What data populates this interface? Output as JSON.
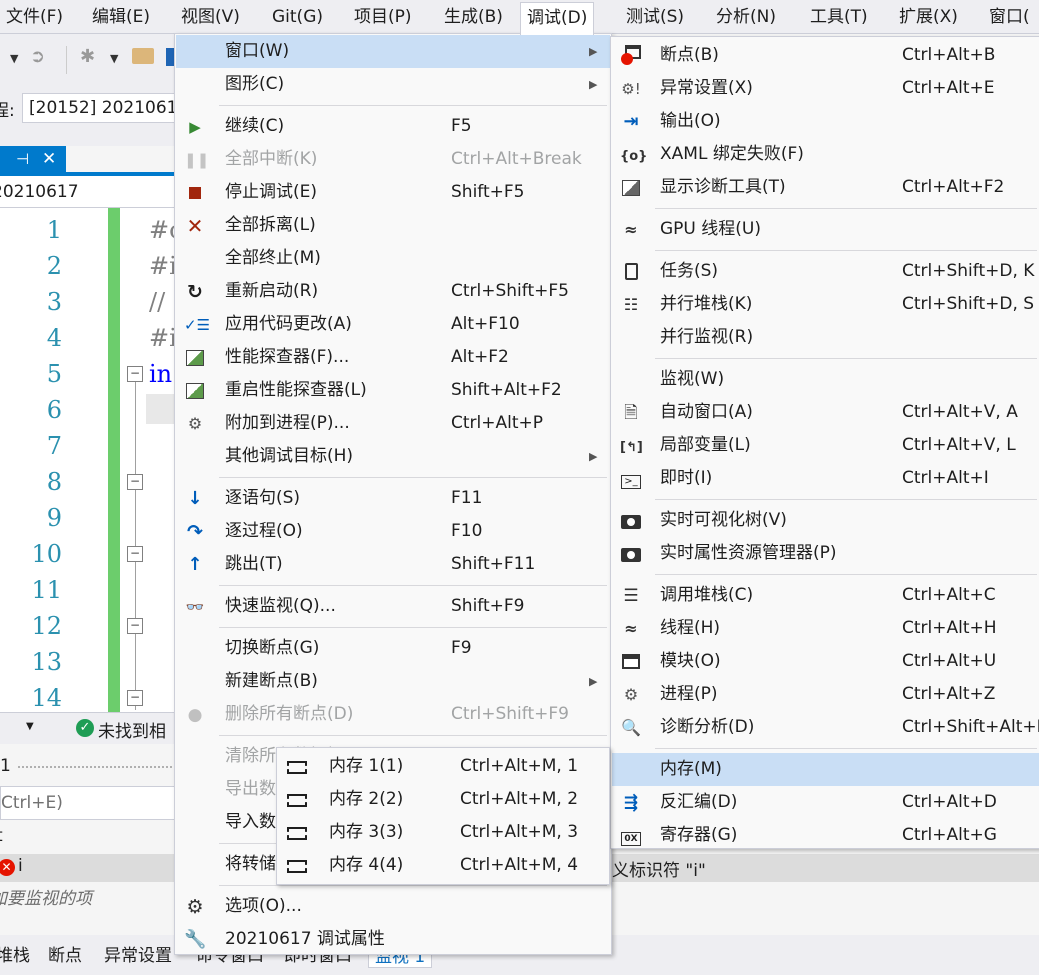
{
  "menubar": [
    "文件(F)",
    "编辑(E)",
    "视图(V)",
    "Git(G)",
    "项目(P)",
    "生成(B)",
    "调试(D)",
    "测试(S)",
    "分析(N)",
    "工具(T)",
    "扩展(X)",
    "窗口("
  ],
  "process_label": "程:",
  "process_value": "[20152] 2021061",
  "doc_tab_pin": "⊣",
  "doc_tab_close": "✕",
  "file_name": "20210617",
  "line_numbers": [
    "1",
    "2",
    "3",
    "4",
    "5",
    "6",
    "7",
    "8",
    "9",
    "10",
    "11",
    "12",
    "13",
    "14"
  ],
  "code_lines": [
    "#c",
    "#i",
    "//",
    "#i",
    "in",
    "{"
  ],
  "status_text": "未找到相关",
  "lower_pane": {
    "row1": "1",
    "search": "Ctrl+E)",
    "row3": "t",
    "watch_item": "i",
    "hint": "加要监视的项"
  },
  "bottom_tabs": [
    "堆栈",
    "断点",
    "异常设置",
    "命令窗口",
    "即时窗口",
    "监视 1"
  ],
  "error_tail": "义标识符 \"i\"",
  "debug_menu": [
    {
      "label": "窗口(W)",
      "shortcut": "",
      "icon": "",
      "submenu": true,
      "highlighted": true
    },
    {
      "label": "图形(C)",
      "shortcut": "",
      "icon": "",
      "submenu": true
    },
    {
      "sep": true
    },
    {
      "label": "继续(C)",
      "shortcut": "F5",
      "icon": "play-icon"
    },
    {
      "label": "全部中断(K)",
      "shortcut": "Ctrl+Alt+Break",
      "icon": "pause-icon",
      "disabled": true
    },
    {
      "label": "停止调试(E)",
      "shortcut": "Shift+F5",
      "icon": "stop-icon"
    },
    {
      "label": "全部拆离(L)",
      "shortcut": "",
      "icon": "detach-icon"
    },
    {
      "label": "全部终止(M)",
      "shortcut": "",
      "icon": ""
    },
    {
      "label": "重新启动(R)",
      "shortcut": "Ctrl+Shift+F5",
      "icon": "restart-icon"
    },
    {
      "label": "应用代码更改(A)",
      "shortcut": "Alt+F10",
      "icon": "apply-changes-icon"
    },
    {
      "label": "性能探查器(F)...",
      "shortcut": "Alt+F2",
      "icon": "profiler-icon"
    },
    {
      "label": "重启性能探查器(L)",
      "shortcut": "Shift+Alt+F2",
      "icon": "profiler-icon"
    },
    {
      "label": "附加到进程(P)...",
      "shortcut": "Ctrl+Alt+P",
      "icon": "attach-process-icon"
    },
    {
      "label": "其他调试目标(H)",
      "shortcut": "",
      "icon": "",
      "submenu": true
    },
    {
      "sep": true
    },
    {
      "label": "逐语句(S)",
      "shortcut": "F11",
      "icon": "step-into-icon"
    },
    {
      "label": "逐过程(O)",
      "shortcut": "F10",
      "icon": "step-over-icon"
    },
    {
      "label": "跳出(T)",
      "shortcut": "Shift+F11",
      "icon": "step-out-icon"
    },
    {
      "sep": true
    },
    {
      "label": "快速监视(Q)...",
      "shortcut": "Shift+F9",
      "icon": "quickwatch-icon"
    },
    {
      "sep": true
    },
    {
      "label": "切换断点(G)",
      "shortcut": "F9",
      "icon": ""
    },
    {
      "label": "新建断点(B)",
      "shortcut": "",
      "icon": "",
      "submenu": true
    },
    {
      "label": "删除所有断点(D)",
      "shortcut": "Ctrl+Shift+F9",
      "icon": "delete-breakpoints-icon",
      "disabled": true
    },
    {
      "sep": true
    },
    {
      "label": "清除所有数据提示(A)",
      "shortcut": "",
      "icon": "",
      "disabled": true
    },
    {
      "label": "导出数据提示(X)...",
      "shortcut": "",
      "icon": "",
      "disabled": true
    },
    {
      "label": "导入数据提示(P)...",
      "shortcut": "",
      "icon": ""
    },
    {
      "sep": true
    },
    {
      "label": "将转储另存为(V)...",
      "shortcut": "",
      "icon": ""
    },
    {
      "sep": true
    },
    {
      "label": "选项(O)...",
      "shortcut": "",
      "icon": "gear-icon"
    },
    {
      "label": "20210617 调试属性",
      "shortcut": "",
      "icon": "wrench-icon"
    }
  ],
  "window_menu": [
    {
      "label": "断点(B)",
      "shortcut": "Ctrl+Alt+B",
      "icon": "breakpoints-icon"
    },
    {
      "label": "异常设置(X)",
      "shortcut": "Ctrl+Alt+E",
      "icon": "exception-settings-icon"
    },
    {
      "label": "输出(O)",
      "shortcut": "",
      "icon": "output-icon"
    },
    {
      "label": "XAML 绑定失败(F)",
      "shortcut": "",
      "icon": "xaml-binding-icon"
    },
    {
      "label": "显示诊断工具(T)",
      "shortcut": "Ctrl+Alt+F2",
      "icon": "diagnostic-tools-icon"
    },
    {
      "sep": true
    },
    {
      "label": "GPU 线程(U)",
      "shortcut": "",
      "icon": "gpu-threads-icon"
    },
    {
      "sep": true
    },
    {
      "label": "任务(S)",
      "shortcut": "Ctrl+Shift+D, K",
      "icon": "tasks-icon"
    },
    {
      "label": "并行堆栈(K)",
      "shortcut": "Ctrl+Shift+D, S",
      "icon": "parallel-stacks-icon"
    },
    {
      "label": "并行监视(R)",
      "shortcut": "",
      "icon": ""
    },
    {
      "sep": true
    },
    {
      "label": "监视(W)",
      "shortcut": "",
      "icon": ""
    },
    {
      "label": "自动窗口(A)",
      "shortcut": "Ctrl+Alt+V, A",
      "icon": "autos-icon"
    },
    {
      "label": "局部变量(L)",
      "shortcut": "Ctrl+Alt+V, L",
      "icon": "locals-icon"
    },
    {
      "label": "即时(I)",
      "shortcut": "Ctrl+Alt+I",
      "icon": "immediate-icon"
    },
    {
      "sep": true
    },
    {
      "label": "实时可视化树(V)",
      "shortcut": "",
      "icon": "camera-icon"
    },
    {
      "label": "实时属性资源管理器(P)",
      "shortcut": "",
      "icon": "camera-icon"
    },
    {
      "sep": true
    },
    {
      "label": "调用堆栈(C)",
      "shortcut": "Ctrl+Alt+C",
      "icon": "call-stack-icon"
    },
    {
      "label": "线程(H)",
      "shortcut": "Ctrl+Alt+H",
      "icon": "threads-icon"
    },
    {
      "label": "模块(O)",
      "shortcut": "Ctrl+Alt+U",
      "icon": "modules-icon"
    },
    {
      "label": "进程(P)",
      "shortcut": "Ctrl+Alt+Z",
      "icon": "processes-icon"
    },
    {
      "label": "诊断分析(D)",
      "shortcut": "Ctrl+Shift+Alt+D",
      "icon": "diagnostic-analysis-icon"
    },
    {
      "sep": true
    },
    {
      "label": "内存(M)",
      "shortcut": "",
      "icon": "",
      "highlighted": true
    },
    {
      "label": "反汇编(D)",
      "shortcut": "Ctrl+Alt+D",
      "icon": "disassembly-icon"
    },
    {
      "label": "寄存器(G)",
      "shortcut": "Ctrl+Alt+G",
      "icon": "registers-icon"
    }
  ],
  "memory_menu": [
    {
      "label": "内存 1(1)",
      "shortcut": "Ctrl+Alt+M, 1",
      "icon": "memory-chip-icon"
    },
    {
      "label": "内存 2(2)",
      "shortcut": "Ctrl+Alt+M, 2",
      "icon": "memory-chip-icon"
    },
    {
      "label": "内存 3(3)",
      "shortcut": "Ctrl+Alt+M, 3",
      "icon": "memory-chip-icon"
    },
    {
      "label": "内存 4(4)",
      "shortcut": "Ctrl+Alt+M, 4",
      "icon": "memory-chip-icon"
    }
  ]
}
